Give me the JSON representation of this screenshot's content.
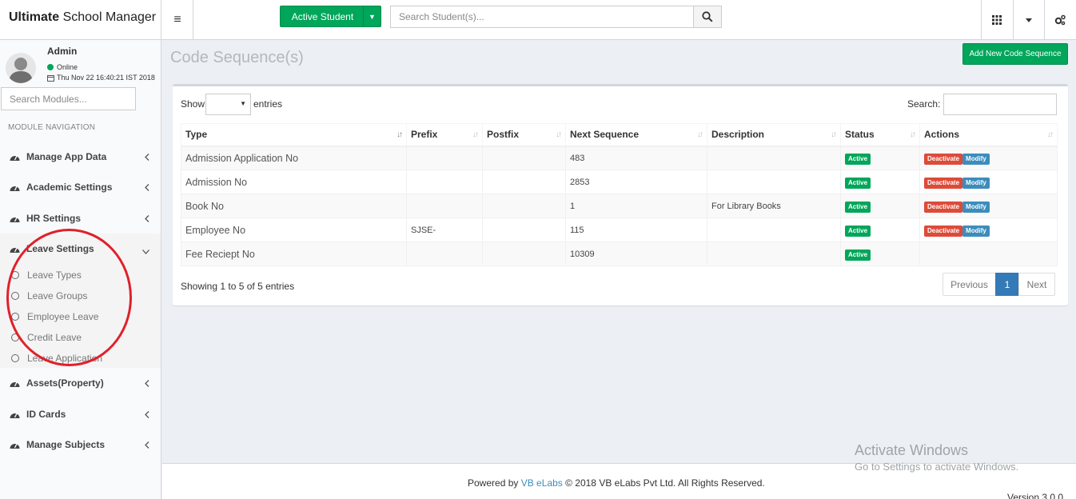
{
  "app": {
    "title_bold": "Ultimate",
    "title_rest": " School Manager"
  },
  "header": {
    "active_student_label": "Active Student",
    "student_search_placeholder": "Search Student(s)..."
  },
  "user": {
    "name": "Admin",
    "status": "Online",
    "datetime": "Thu Nov 22 16:40:21 IST 2018"
  },
  "sidebar": {
    "search_placeholder": "Search Modules...",
    "nav_header": "MODULE NAVIGATION",
    "items": [
      {
        "label": "Manage App Data"
      },
      {
        "label": "Academic Settings"
      },
      {
        "label": "HR Settings"
      },
      {
        "label": "Leave Settings"
      },
      {
        "label": "Assets(Property)"
      },
      {
        "label": "ID Cards"
      },
      {
        "label": "Manage Subjects"
      }
    ],
    "leave_submenu": [
      {
        "label": "Leave Types"
      },
      {
        "label": "Leave Groups"
      },
      {
        "label": "Employee Leave"
      },
      {
        "label": "Credit Leave"
      },
      {
        "label": "Leave Application"
      }
    ]
  },
  "page": {
    "title": "Code Sequence(s)",
    "add_button": "Add New Code Sequence"
  },
  "table": {
    "show_label": "Show",
    "entries_label": "entries",
    "search_label": "Search:",
    "columns": [
      "Type",
      "Prefix",
      "Postfix",
      "Next Sequence",
      "Description",
      "Status",
      "Actions"
    ],
    "rows": [
      {
        "type": "Admission Application No",
        "prefix": "",
        "postfix": "",
        "next": "483",
        "description": "",
        "status": "Active",
        "actions": [
          "Deactivate",
          "Modify"
        ]
      },
      {
        "type": "Admission No",
        "prefix": "",
        "postfix": "",
        "next": "2853",
        "description": "",
        "status": "Active",
        "actions": [
          "Deactivate",
          "Modify"
        ]
      },
      {
        "type": "Book No",
        "prefix": "",
        "postfix": "",
        "next": "1",
        "description": "For Library Books",
        "status": "Active",
        "actions": [
          "Deactivate",
          "Modify"
        ]
      },
      {
        "type": "Employee No",
        "prefix": "SJSE-",
        "postfix": "",
        "next": "115",
        "description": "",
        "status": "Active",
        "actions": [
          "Deactivate",
          "Modify"
        ]
      },
      {
        "type": "Fee Reciept No",
        "prefix": "",
        "postfix": "",
        "next": "10309",
        "description": "",
        "status": "Active",
        "actions": []
      }
    ],
    "info": "Showing 1 to 5 of 5 entries",
    "pagination": {
      "previous": "Previous",
      "current": "1",
      "next": "Next"
    }
  },
  "footer": {
    "powered_by": "Powered by",
    "link": "VB eLabs",
    "copyright": "© 2018 VB eLabs Pvt Ltd. All Rights Reserved.",
    "version": "Version 3.0.0"
  },
  "watermark": {
    "line1": "Activate Windows",
    "line2": "Go to Settings to activate Windows."
  },
  "colors": {
    "success": "#00a65a",
    "danger": "#dd4b39",
    "primary": "#3c8dbc",
    "annotation": "#e0202a"
  }
}
